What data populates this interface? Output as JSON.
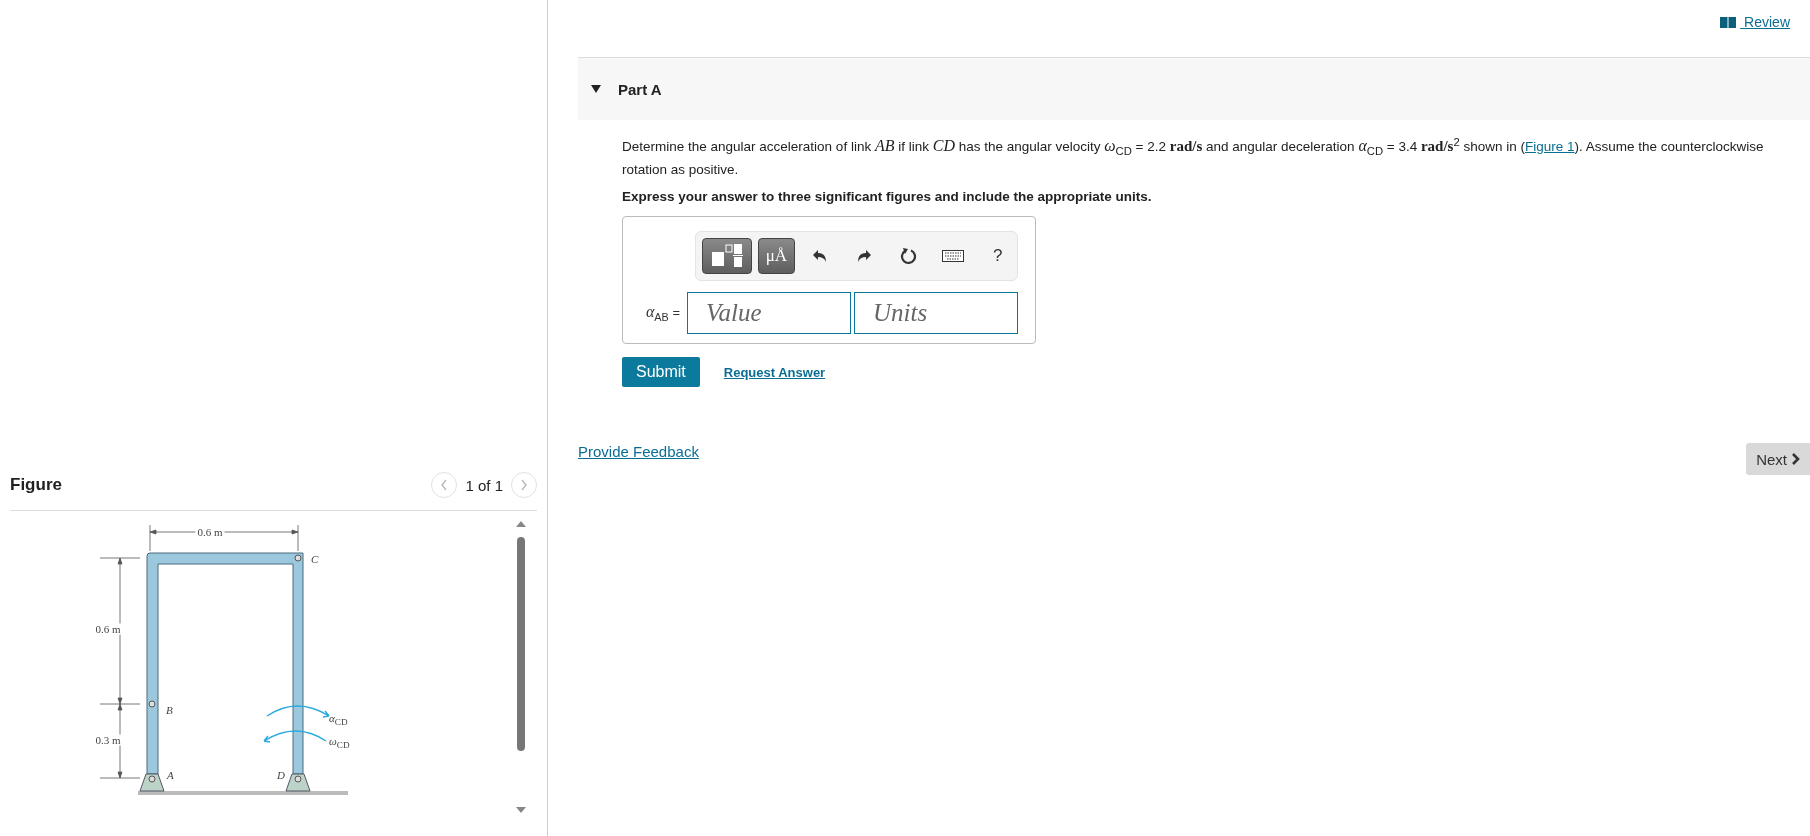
{
  "review_link": "Review",
  "part": {
    "title": "Part A",
    "expanded": true
  },
  "question": {
    "before": "Determine the angular acceleration of link *AB* if link *CD* has the angular velocity *ω*$_{CD}$ = 2.2 **rad/s** and angular deceleration *α*$_{CD}$ = 3.4 **rad/s**$^{2}$ shown in (",
    "figure_link": "Figure 1",
    "after": "). Assume the counterclockwise rotation as positive."
  },
  "instruction": "Express your answer to three significant figures and include the appropriate units.",
  "answer": {
    "label": "*α*$_{AB}$ =",
    "units_button": "μÅ",
    "help": "?",
    "value_placeholder": "Value",
    "units_placeholder": "Units"
  },
  "submit": "Submit",
  "request_answer": "Request Answer",
  "feedback": "Provide Feedback",
  "next": "Next",
  "figure": {
    "title": "Figure",
    "pager": "1 of 1",
    "labels": [
      {
        "text": "0.6 m"
      },
      {
        "text": "0.6 m"
      },
      {
        "text": "0.3 m"
      },
      {
        "text": "*A*"
      },
      {
        "text": "*B*"
      },
      {
        "text": "*C*"
      },
      {
        "text": "*D*"
      },
      {
        "text": "*α*$_{CD}$"
      },
      {
        "text": "*ω*$_{CD}$"
      }
    ]
  }
}
